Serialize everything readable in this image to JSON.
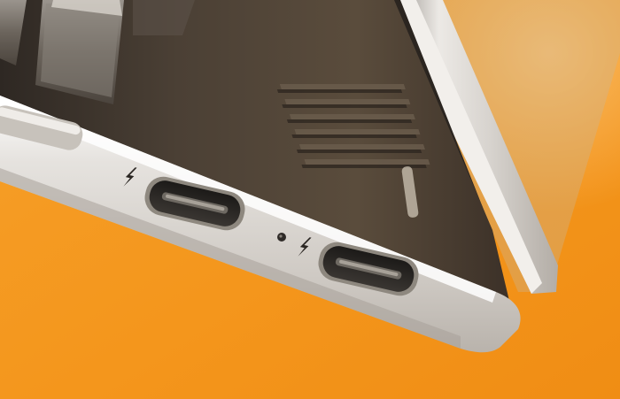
{
  "scene": {
    "subject": "laptop-edge-thunderbolt-ports",
    "background_color": "#f49a22",
    "chassis_color": "#d9d6d2",
    "deck_color": "#4a3f33",
    "port_count": 2
  },
  "ports": [
    {
      "name": "left-usb-c-port",
      "icon": "thunderbolt-icon"
    },
    {
      "name": "right-usb-c-port",
      "icon": "thunderbolt-icon"
    }
  ],
  "indicators": [
    {
      "name": "status-led",
      "icon": "led-dot-icon"
    }
  ]
}
